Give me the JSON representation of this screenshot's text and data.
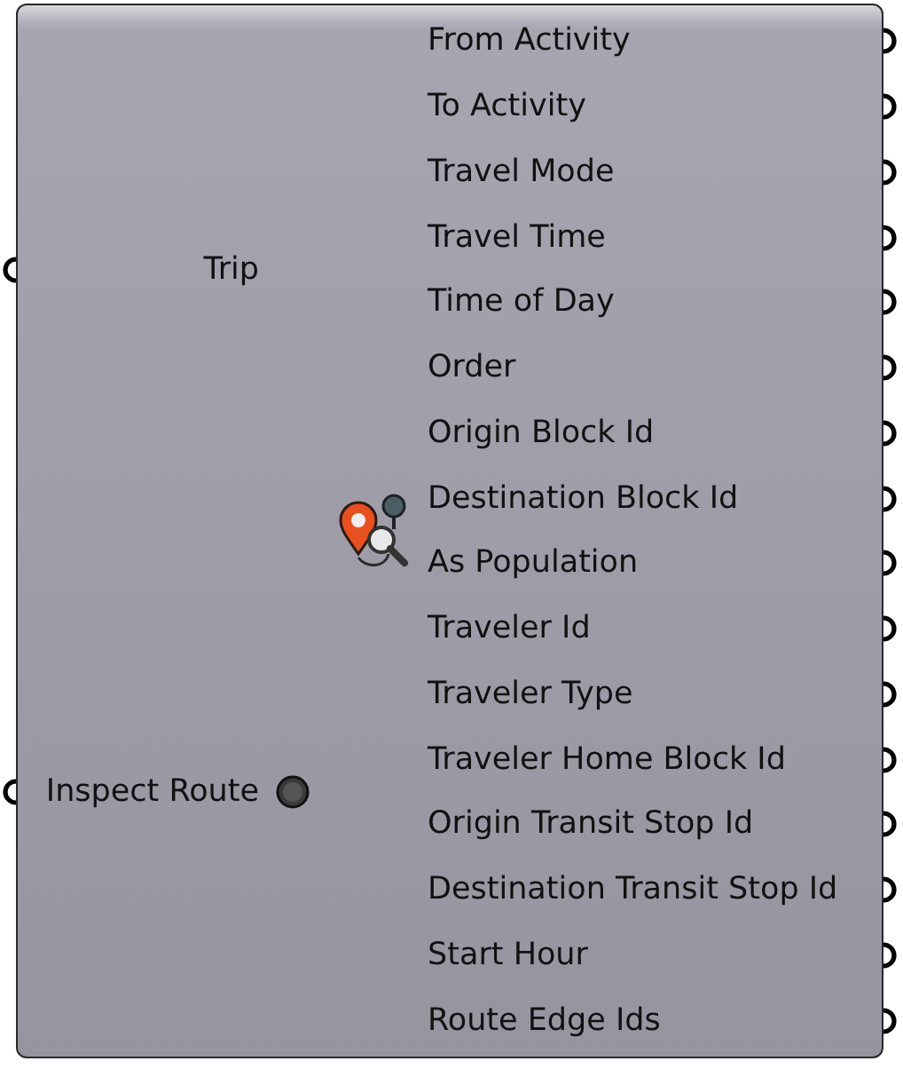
{
  "component": {
    "inputs": [
      {
        "label": "Trip",
        "kind": "data"
      },
      {
        "label": "Inspect Route",
        "kind": "toggle"
      }
    ],
    "outputs": [
      "From Activity",
      "To Activity",
      "Travel Mode",
      "Travel Time",
      "Time of Day",
      "Order",
      "Origin Block Id",
      "Destination Block Id",
      "As Population",
      "Traveler Id",
      "Traveler Type",
      "Traveler Home Block Id",
      "Origin Transit Stop Id",
      "Destination Transit Stop Id",
      "Start Hour",
      "Route Edge Ids"
    ]
  }
}
